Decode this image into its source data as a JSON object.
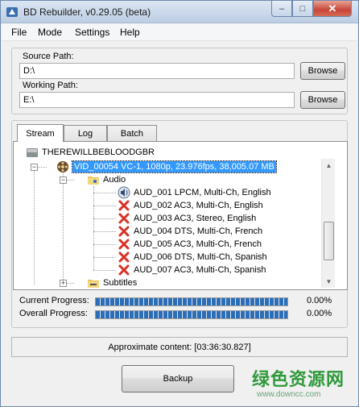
{
  "window": {
    "title": "BD Rebuilder, v0.29.05 (beta)",
    "minimize_glyph": "–",
    "maximize_glyph": "□",
    "close_glyph": "✕"
  },
  "menu": {
    "items": [
      {
        "label": "File"
      },
      {
        "label": "Mode"
      },
      {
        "label": "Settings"
      },
      {
        "label": "Help"
      }
    ]
  },
  "paths": {
    "source_label": "Source Path:",
    "source_value": "D:\\",
    "working_label": "Working Path:",
    "working_value": "E:\\",
    "browse_label": "Browse"
  },
  "tabs": [
    {
      "label": "Stream",
      "active": true
    },
    {
      "label": "Log",
      "active": false
    },
    {
      "label": "Batch",
      "active": false
    }
  ],
  "tree": {
    "root": {
      "label": "THEREWILLBEBLOODGBR",
      "icon": "disc-drive-icon"
    },
    "video": {
      "label": "VID_00054 VC-1, 1080p, 23.976fps, 38,005.07 MB",
      "icon": "video-reel-icon",
      "selected": true
    },
    "audio_folder": {
      "label": "Audio",
      "icon": "audio-folder-icon"
    },
    "audio_tracks": [
      {
        "label": "AUD_001 LPCM, Multi-Ch, English",
        "icon": "speaker-icon",
        "status": "keep"
      },
      {
        "label": "AUD_002 AC3, Multi-Ch, English",
        "icon": "red-x-icon",
        "status": "remove"
      },
      {
        "label": "AUD_003 AC3, Stereo, English",
        "icon": "red-x-icon",
        "status": "remove"
      },
      {
        "label": "AUD_004 DTS, Multi-Ch, French",
        "icon": "red-x-icon",
        "status": "remove"
      },
      {
        "label": "AUD_005 AC3, Multi-Ch, French",
        "icon": "red-x-icon",
        "status": "remove"
      },
      {
        "label": "AUD_006 DTS, Multi-Ch, Spanish",
        "icon": "red-x-icon",
        "status": "remove"
      },
      {
        "label": "AUD_007 AC3, Multi-Ch, Spanish",
        "icon": "red-x-icon",
        "status": "remove"
      }
    ],
    "subtitles_folder": {
      "label": "Subtitles",
      "icon": "subtitles-folder-icon"
    }
  },
  "progress": {
    "current_label": "Current Progress:",
    "current_value": "0.00%",
    "current_fraction": 1.0,
    "overall_label": "Overall Progress:",
    "overall_value": "0.00%",
    "overall_fraction": 1.0
  },
  "status": {
    "approx_content": "Approximate content: [03:36:30.827]"
  },
  "actions": {
    "backup_label": "Backup"
  },
  "watermark": {
    "brand_text": "绿色资源网",
    "url_text": "www.downcc.com"
  },
  "colors": {
    "selection": "#3399ff",
    "progress_fill": "#2a6db8",
    "remove_icon": "#d93025",
    "close_button": "#c7453a",
    "watermark_green": "#2f9a3c"
  }
}
